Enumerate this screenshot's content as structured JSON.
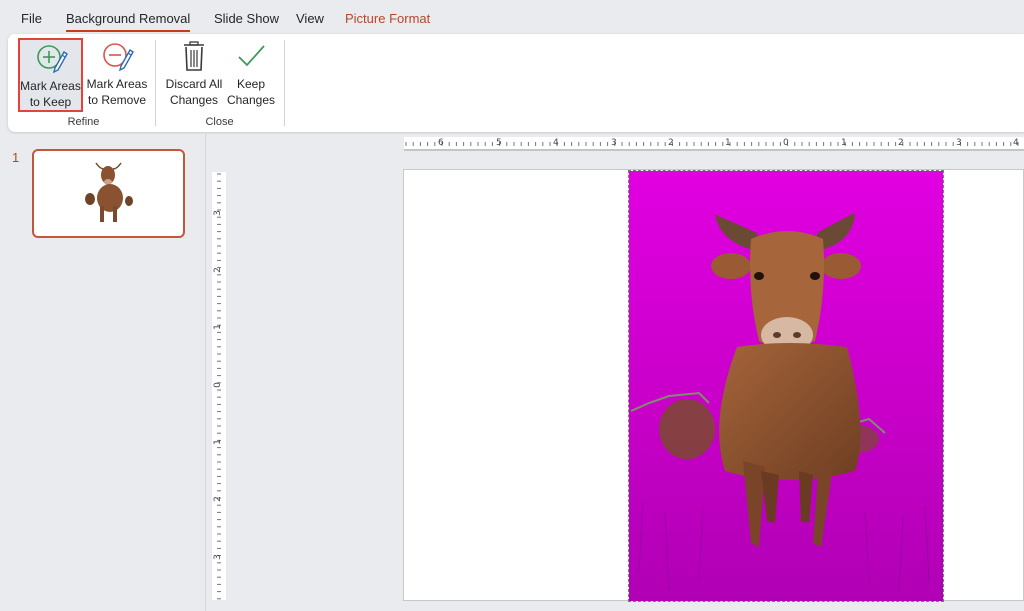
{
  "tabs": [
    {
      "label": "File"
    },
    {
      "label": "Background Removal"
    },
    {
      "label": "Slide Show"
    },
    {
      "label": "View"
    },
    {
      "label": "Picture Format"
    }
  ],
  "ribbon": {
    "mark_keep_line1": "Mark Areas",
    "mark_keep_line2": "to Keep",
    "mark_remove_line1": "Mark Areas",
    "mark_remove_line2": "to Remove",
    "discard_line1": "Discard All",
    "discard_line2": "Changes",
    "keep_line1": "Keep",
    "keep_line2": "Changes",
    "group_refine": "Refine",
    "group_close": "Close"
  },
  "slides": [
    {
      "number": "1"
    }
  ],
  "hruler_labels": [
    "6",
    "5",
    "4",
    "3",
    "2",
    "1",
    "0",
    "1",
    "2",
    "3",
    "4"
  ],
  "vruler_labels": [
    "3",
    "2",
    "1",
    "0",
    "1",
    "2",
    "3"
  ],
  "colors": {
    "accent": "#c43e1c",
    "removal_overlay": "#d600d6",
    "selected_border": "#e0453a",
    "keep_icon": "#3c9a54",
    "remove_icon": "#d9534f"
  }
}
